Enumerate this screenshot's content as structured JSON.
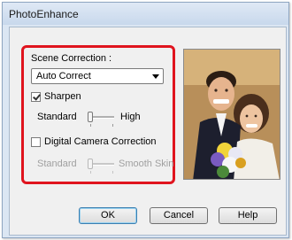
{
  "window": {
    "title": "PhotoEnhance"
  },
  "scene_correction": {
    "label": "Scene Correction :",
    "selected": "Auto Correct"
  },
  "sharpen": {
    "label": "Sharpen",
    "checked": true,
    "min_label": "Standard",
    "max_label": "High",
    "level": 0
  },
  "digital_camera": {
    "label": "Digital Camera Correction",
    "checked": false,
    "min_label": "Standard",
    "max_label": "Smooth Skin",
    "level": 0
  },
  "buttons": {
    "ok": "OK",
    "cancel": "Cancel",
    "help": "Help"
  },
  "colors": {
    "highlight": "#e0141e"
  }
}
